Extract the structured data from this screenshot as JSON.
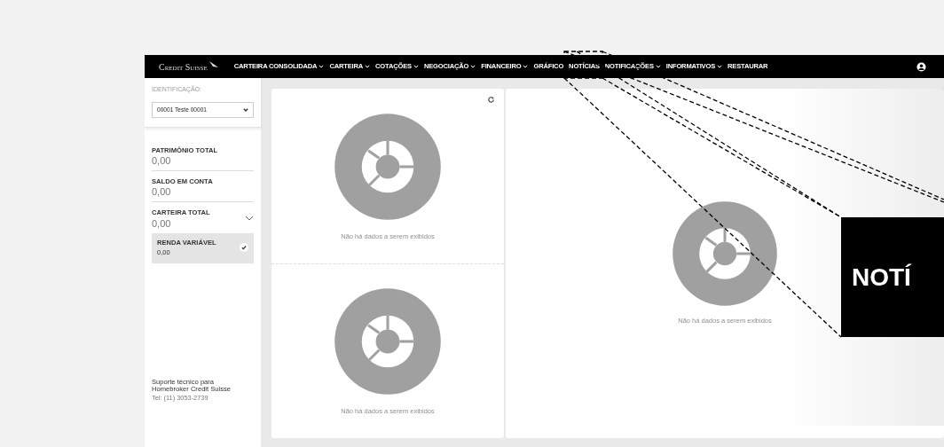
{
  "navbar": {
    "brand": "Credit Suisse",
    "items": [
      {
        "label": "CARTEIRA CONSOLIDADA",
        "dropdown": true
      },
      {
        "label": "CARTEIRA",
        "dropdown": true
      },
      {
        "label": "COTAÇÕES",
        "dropdown": true
      },
      {
        "label": "NEGOCIAÇÃO",
        "dropdown": true
      },
      {
        "label": "FINANCEIRO",
        "dropdown": true
      },
      {
        "label": "GRÁFICO",
        "dropdown": false
      },
      {
        "label": "NOTÍCIAS",
        "dropdown": false
      },
      {
        "label": "NOTIFICAÇÕES",
        "dropdown": true
      },
      {
        "label": "INFORMATIVOS",
        "dropdown": true
      },
      {
        "label": "RESTAURAR",
        "dropdown": false
      }
    ]
  },
  "sidebar": {
    "label": "IDENTIFICAÇÃO:",
    "select_value": "00001 Teste 00001",
    "stats": [
      {
        "label": "PATRIMÔNIO TOTAL",
        "value": "0,00",
        "expandable": false
      },
      {
        "label": "SALDO EM CONTA",
        "value": "0,00",
        "expandable": false
      },
      {
        "label": "CARTEIRA TOTAL",
        "value": "0,00",
        "expandable": true,
        "expanded": true,
        "children": [
          {
            "label": "RENDA VARIÁVEL",
            "value": "0,00",
            "checked": true
          }
        ]
      }
    ],
    "support": {
      "text": "Suporte técnico para Homebroker Credit Suisse",
      "phone": "Tel: (11) 3053-2739"
    }
  },
  "left_widgets": [
    {
      "message": "Não há dados a serem exibidos",
      "refresh": true
    },
    {
      "message": "Não há dados a serem exibidos",
      "refresh": false
    }
  ],
  "right_widgets": [
    {
      "message": "Não há dados a serem exibidos",
      "refresh": false
    }
  ],
  "callout": {
    "text": "NOTÍ"
  }
}
